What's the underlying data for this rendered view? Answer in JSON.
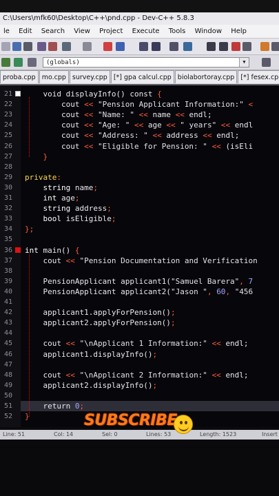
{
  "window": {
    "title": "C:\\Users\\mfk60\\Desktop\\C++\\pnd.cpp - Dev-C++ 5.8.3"
  },
  "menu": [
    "le",
    "Edit",
    "Search",
    "View",
    "Project",
    "Execute",
    "Tools",
    "Window",
    "Help"
  ],
  "scope_select": {
    "value": "(globals)"
  },
  "tabs": [
    "proba.cpp",
    "mo.cpp",
    "survey.cpp",
    "[*] gpa calcul.cpp",
    "biolabortoray.cpp",
    "[*] fesex.cpp",
    "pn"
  ],
  "active_tab_index": 6,
  "editor": {
    "lines": [
      {
        "n": "21",
        "fold": "box",
        "code": [
          [
            "    ",
            ""
          ],
          [
            "void ",
            "kw"
          ],
          [
            "displayInfo() ",
            "id"
          ],
          [
            "const ",
            "kw"
          ],
          [
            "{",
            "op"
          ]
        ]
      },
      {
        "n": "22",
        "code": [
          [
            "        ",
            ""
          ],
          [
            "cout ",
            "id"
          ],
          [
            "<< ",
            "op"
          ],
          [
            "\"Pension Applicant Information:\" ",
            "str"
          ],
          [
            "<",
            "op"
          ]
        ]
      },
      {
        "n": "23",
        "code": [
          [
            "        ",
            ""
          ],
          [
            "cout ",
            "id"
          ],
          [
            "<< ",
            "op"
          ],
          [
            "\"Name: \" ",
            "str"
          ],
          [
            "<< ",
            "op"
          ],
          [
            "name ",
            "id"
          ],
          [
            "<< ",
            "op"
          ],
          [
            "endl;",
            "id"
          ]
        ]
      },
      {
        "n": "24",
        "code": [
          [
            "        ",
            ""
          ],
          [
            "cout ",
            "id"
          ],
          [
            "<< ",
            "op"
          ],
          [
            "\"Age: \" ",
            "str"
          ],
          [
            "<< ",
            "op"
          ],
          [
            "age ",
            "id"
          ],
          [
            "<< ",
            "op"
          ],
          [
            "\" years\" ",
            "str"
          ],
          [
            "<< ",
            "op"
          ],
          [
            "endl",
            "id"
          ]
        ]
      },
      {
        "n": "25",
        "code": [
          [
            "        ",
            ""
          ],
          [
            "cout ",
            "id"
          ],
          [
            "<< ",
            "op"
          ],
          [
            "\"Address: \" ",
            "str"
          ],
          [
            "<< ",
            "op"
          ],
          [
            "address ",
            "id"
          ],
          [
            "<< ",
            "op"
          ],
          [
            "endl;",
            "id"
          ]
        ]
      },
      {
        "n": "26",
        "code": [
          [
            "        ",
            ""
          ],
          [
            "cout ",
            "id"
          ],
          [
            "<< ",
            "op"
          ],
          [
            "\"Eligible for Pension: \" ",
            "str"
          ],
          [
            "<< ",
            "op"
          ],
          [
            "(isEli",
            "id"
          ]
        ]
      },
      {
        "n": "27",
        "code": [
          [
            "    ",
            ""
          ],
          [
            "}",
            "op"
          ]
        ]
      },
      {
        "n": "28",
        "code": []
      },
      {
        "n": "29",
        "code": [
          [
            "",
            ""
          ],
          [
            "private",
            "lbl"
          ],
          [
            ":",
            "op"
          ]
        ]
      },
      {
        "n": "30",
        "code": [
          [
            "    ",
            ""
          ],
          [
            "string ",
            "ty"
          ],
          [
            "name",
            "id"
          ],
          [
            ";",
            "op"
          ]
        ]
      },
      {
        "n": "31",
        "code": [
          [
            "    ",
            ""
          ],
          [
            "int ",
            "ty"
          ],
          [
            "age",
            "id"
          ],
          [
            ";",
            "op"
          ]
        ]
      },
      {
        "n": "32",
        "code": [
          [
            "    ",
            ""
          ],
          [
            "string ",
            "ty"
          ],
          [
            "address",
            "id"
          ],
          [
            ";",
            "op"
          ]
        ]
      },
      {
        "n": "33",
        "code": [
          [
            "    ",
            ""
          ],
          [
            "bool ",
            "ty"
          ],
          [
            "isEligible",
            "id"
          ],
          [
            ";",
            "op"
          ]
        ]
      },
      {
        "n": "34",
        "code": [
          [
            "",
            ""
          ],
          [
            "};",
            "op"
          ]
        ]
      },
      {
        "n": "35",
        "code": []
      },
      {
        "n": "36",
        "fold": "red",
        "code": [
          [
            "",
            ""
          ],
          [
            "int ",
            "ty"
          ],
          [
            "main() ",
            "id"
          ],
          [
            "{",
            "op"
          ]
        ]
      },
      {
        "n": "37",
        "code": [
          [
            "    ",
            ""
          ],
          [
            "cout ",
            "id"
          ],
          [
            "<< ",
            "op"
          ],
          [
            "\"Pension Documentation and Verification",
            "str"
          ]
        ]
      },
      {
        "n": "38",
        "code": []
      },
      {
        "n": "39",
        "code": [
          [
            "    ",
            ""
          ],
          [
            "PensionApplicant ",
            "id"
          ],
          [
            "applicant1(",
            "id"
          ],
          [
            "\"Samuel Barera\"",
            "str"
          ],
          [
            ", ",
            "op"
          ],
          [
            "7",
            "num"
          ]
        ]
      },
      {
        "n": "40",
        "code": [
          [
            "    ",
            ""
          ],
          [
            "PensionApplicant ",
            "id"
          ],
          [
            "applicant2(",
            "id"
          ],
          [
            "\"Jason \"",
            "str"
          ],
          [
            ", ",
            "op"
          ],
          [
            "60",
            "num"
          ],
          [
            ", ",
            "op"
          ],
          [
            "\"456",
            "str"
          ]
        ]
      },
      {
        "n": "41",
        "code": []
      },
      {
        "n": "42",
        "code": [
          [
            "    ",
            ""
          ],
          [
            "applicant1.applyForPension()",
            "id"
          ],
          [
            ";",
            "op"
          ]
        ]
      },
      {
        "n": "43",
        "code": [
          [
            "    ",
            ""
          ],
          [
            "applicant2.applyForPension()",
            "id"
          ],
          [
            ";",
            "op"
          ]
        ]
      },
      {
        "n": "44",
        "code": []
      },
      {
        "n": "45",
        "code": [
          [
            "    ",
            ""
          ],
          [
            "cout ",
            "id"
          ],
          [
            "<< ",
            "op"
          ],
          [
            "\"\\nApplicant 1 Information:\" ",
            "str"
          ],
          [
            "<< ",
            "op"
          ],
          [
            "endl;",
            "id"
          ]
        ]
      },
      {
        "n": "46",
        "code": [
          [
            "    ",
            ""
          ],
          [
            "applicant1.displayInfo()",
            "id"
          ],
          [
            ";",
            "op"
          ]
        ]
      },
      {
        "n": "47",
        "code": []
      },
      {
        "n": "48",
        "code": [
          [
            "    ",
            ""
          ],
          [
            "cout ",
            "id"
          ],
          [
            "<< ",
            "op"
          ],
          [
            "\"\\nApplicant 2 Information:\" ",
            "str"
          ],
          [
            "<< ",
            "op"
          ],
          [
            "endl;",
            "id"
          ]
        ]
      },
      {
        "n": "49",
        "code": [
          [
            "    ",
            ""
          ],
          [
            "applicant2.displayInfo()",
            "id"
          ],
          [
            ";",
            "op"
          ]
        ]
      },
      {
        "n": "50",
        "code": []
      },
      {
        "n": "51",
        "cursor": true,
        "code": [
          [
            "    ",
            ""
          ],
          [
            "return ",
            "kw"
          ],
          [
            "0",
            "num"
          ],
          [
            ";",
            "op"
          ]
        ]
      },
      {
        "n": "52",
        "code": [
          [
            "",
            ""
          ],
          [
            "}",
            "op"
          ]
        ]
      }
    ]
  },
  "status": {
    "line": "Line:    51",
    "col": "Col:    14",
    "sel": "Sel:    0",
    "lines": "Lines:    53",
    "length": "Length:  1523",
    "mode": "Insert"
  },
  "overlay": {
    "text": "SUBSCRIBE"
  },
  "colors": {
    "operator": "#ff5a3c",
    "label": "#ffd84a",
    "number": "#a5a5ff",
    "overlay": "#ff7a1a"
  },
  "icons": [
    "new-file-icon",
    "open-icon",
    "save-icon",
    "save-all-icon",
    "close-icon",
    "print-icon",
    "undo-icon",
    "redo-icon",
    "find-icon",
    "replace-icon",
    "compile-icon",
    "run-icon",
    "debug-icon",
    "grid-icon"
  ]
}
